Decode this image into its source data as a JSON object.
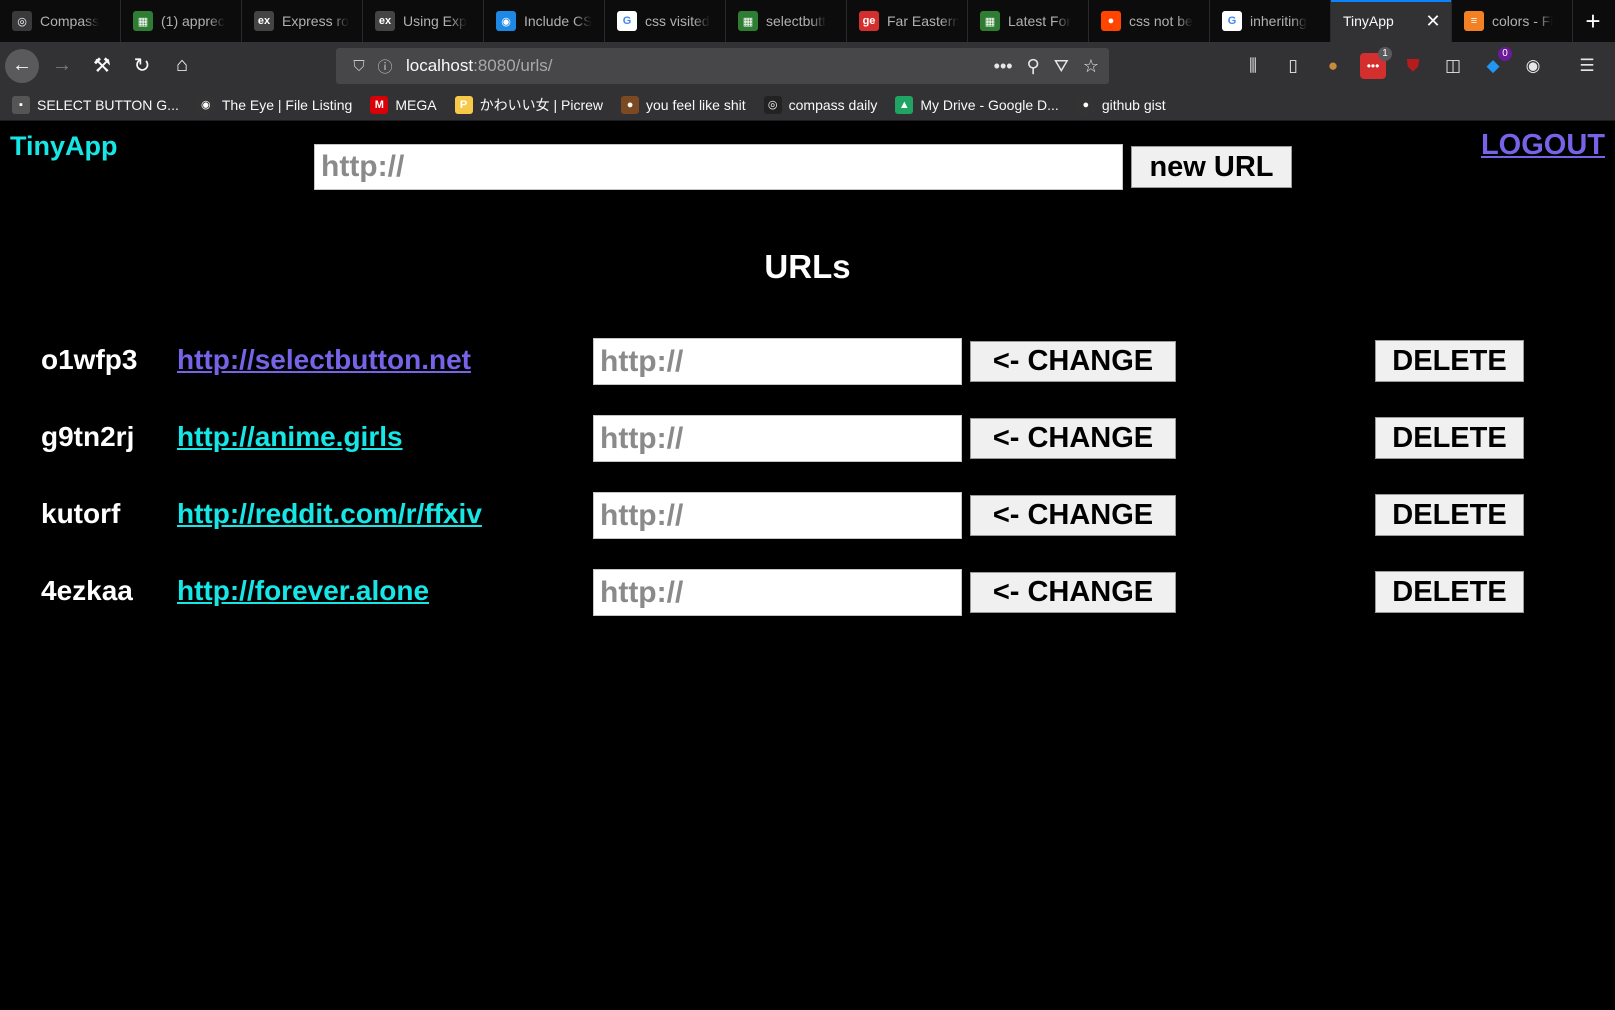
{
  "browser": {
    "tabs": [
      {
        "label": "Compass",
        "icon": "compass-icon",
        "color": "#3a3a3c",
        "glyph": "◎"
      },
      {
        "label": "(1) apprec",
        "icon": "grid-favicon-icon",
        "color": "#2e7d32",
        "glyph": "▦"
      },
      {
        "label": "Express ro",
        "icon": "ex-favicon-icon",
        "color": "#444444",
        "glyph": "ex"
      },
      {
        "label": "Using Exp",
        "icon": "ex-favicon-icon",
        "color": "#444444",
        "glyph": "ex"
      },
      {
        "label": "Include CS",
        "icon": "eye-favicon-icon",
        "color": "#1e88e5",
        "glyph": "◉"
      },
      {
        "label": "css visited",
        "icon": "google-icon",
        "color": "#ffffff",
        "glyph": "G"
      },
      {
        "label": "selectbutt",
        "icon": "grid-favicon-icon",
        "color": "#2e7d32",
        "glyph": "▦"
      },
      {
        "label": "Far Eastern",
        "icon": "ge-favicon-icon",
        "color": "#d32f2f",
        "glyph": "ge"
      },
      {
        "label": "Latest For",
        "icon": "grid-favicon-icon",
        "color": "#2e7d32",
        "glyph": "▦"
      },
      {
        "label": "css not be",
        "icon": "reddit-icon",
        "color": "#ff4500",
        "glyph": "●"
      },
      {
        "label": "inheriting",
        "icon": "google-icon",
        "color": "#ffffff",
        "glyph": "G"
      },
      {
        "label": "TinyApp",
        "icon": "",
        "color": "",
        "glyph": "",
        "active": true
      },
      {
        "label": "colors - Fi",
        "icon": "stackoverflow-icon",
        "color": "#f48024",
        "glyph": "≡"
      }
    ],
    "url_host": "localhost",
    "url_path": ":8080/urls/",
    "bookmarks": [
      {
        "label": "SELECT BUTTON G...",
        "icon": "select-button-favicon-icon",
        "color": "#555555",
        "glyph": "▪"
      },
      {
        "label": "The Eye | File Listing",
        "icon": "eye-favicon-icon",
        "color": "#333333",
        "glyph": "◉"
      },
      {
        "label": "MEGA",
        "icon": "mega-icon",
        "color": "#d90007",
        "glyph": "M"
      },
      {
        "label": "かわいい女 | Picrew",
        "icon": "picrew-icon",
        "color": "#f7c948",
        "glyph": "P"
      },
      {
        "label": "you feel like shit",
        "icon": "poop-icon",
        "color": "#7b4a22",
        "glyph": "●"
      },
      {
        "label": "compass daily",
        "icon": "compass-icon",
        "color": "#222222",
        "glyph": "◎"
      },
      {
        "label": "My Drive - Google D...",
        "icon": "google-drive-icon",
        "color": "#1fa463",
        "glyph": "▲"
      },
      {
        "label": "github gist",
        "icon": "github-icon",
        "color": "#333333",
        "glyph": "●"
      }
    ],
    "toolbar_badges": {
      "todo": "1",
      "notify": "0"
    }
  },
  "app": {
    "brand": "TinyApp",
    "logout_label": "LOGOUT",
    "new_url_placeholder": "http://",
    "new_url_button": "new URL",
    "heading": "URLs",
    "colors": {
      "brand": "#17e6e6",
      "link": "#17e6e6",
      "visited": "#7663e8"
    },
    "urls": [
      {
        "code": "o1wfp3",
        "long_url": "http://selectbutton.net",
        "visited": true,
        "edit_placeholder": "http://",
        "change_label": "<- CHANGE",
        "delete_label": "DELETE"
      },
      {
        "code": "g9tn2rj",
        "long_url": "http://anime.girls",
        "visited": false,
        "edit_placeholder": "http://",
        "change_label": "<- CHANGE",
        "delete_label": "DELETE"
      },
      {
        "code": "kutorf",
        "long_url": "http://reddit.com/r/ffxiv",
        "visited": false,
        "edit_placeholder": "http://",
        "change_label": "<- CHANGE",
        "delete_label": "DELETE"
      },
      {
        "code": "4ezkaa",
        "long_url": "http://forever.alone",
        "visited": false,
        "edit_placeholder": "http://",
        "change_label": "<- CHANGE",
        "delete_label": "DELETE"
      }
    ]
  }
}
